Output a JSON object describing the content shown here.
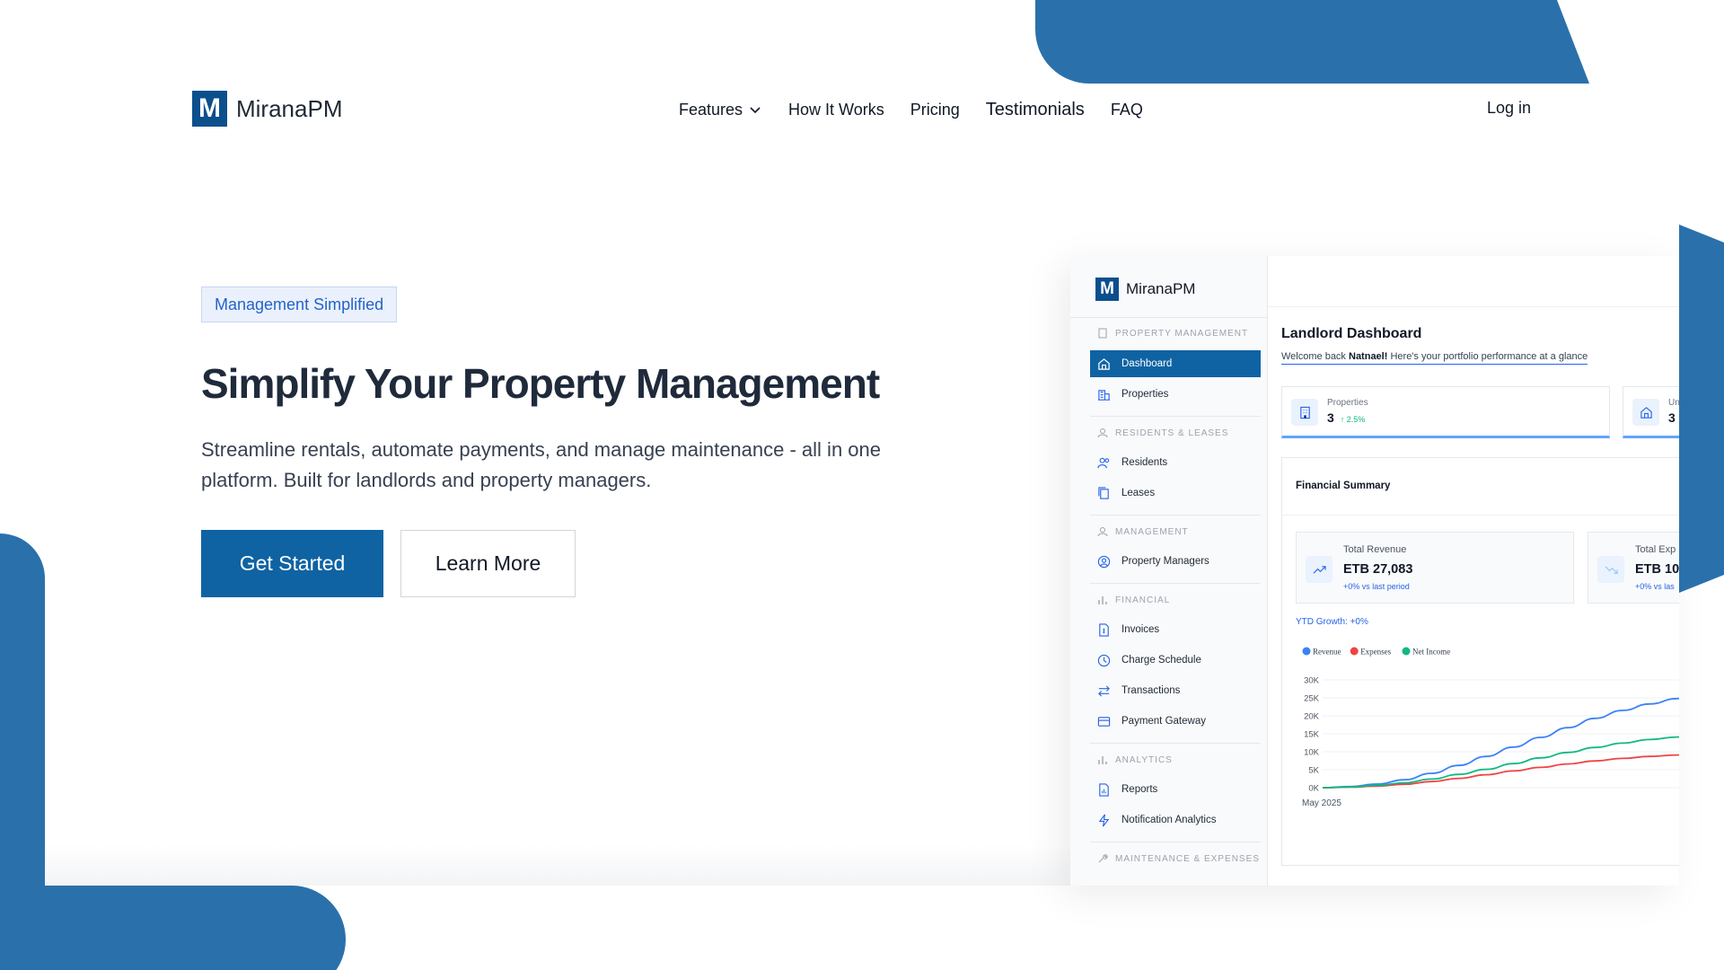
{
  "brand": {
    "name": "MiranaPM",
    "mark": "M",
    "color": "#0b4f8c"
  },
  "nav": {
    "items": [
      {
        "label": "Features",
        "has_dropdown": true
      },
      {
        "label": "How It Works"
      },
      {
        "label": "Pricing"
      },
      {
        "label": "Testimonials"
      },
      {
        "label": "FAQ"
      }
    ],
    "login": "Log in"
  },
  "hero": {
    "badge": "Management Simplified",
    "title": "Simplify Your Property Management",
    "subtitle": "Streamline rentals, automate payments, and manage maintenance - all in one platform. Built for landlords and property managers.",
    "primary_button": "Get Started",
    "secondary_button": "Learn More"
  },
  "colors": {
    "accent": "#0f63a3",
    "decor": "#2a71ac",
    "badge_text": "#2563c9"
  },
  "dashboard": {
    "brand": "MiranaPM",
    "sidebar": {
      "sections": [
        {
          "title": "PROPERTY MANAGEMENT",
          "items": [
            {
              "label": "Dashboard",
              "icon": "home-icon",
              "active": true
            },
            {
              "label": "Properties",
              "icon": "building-icon"
            }
          ]
        },
        {
          "title": "RESIDENTS & LEASES",
          "items": [
            {
              "label": "Residents",
              "icon": "users-icon"
            },
            {
              "label": "Leases",
              "icon": "copy-icon"
            }
          ]
        },
        {
          "title": "MANAGEMENT",
          "items": [
            {
              "label": "Property Managers",
              "icon": "user-circle-icon"
            }
          ]
        },
        {
          "title": "FINANCIAL",
          "items": [
            {
              "label": "Invoices",
              "icon": "invoice-icon"
            },
            {
              "label": "Charge Schedule",
              "icon": "clock-icon"
            },
            {
              "label": "Transactions",
              "icon": "swap-icon"
            },
            {
              "label": "Payment Gateway",
              "icon": "card-icon"
            }
          ]
        },
        {
          "title": "ANALYTICS",
          "items": [
            {
              "label": "Reports",
              "icon": "report-icon"
            },
            {
              "label": "Notification Analytics",
              "icon": "bolt-icon"
            }
          ]
        },
        {
          "title": "MAINTENANCE & EXPENSES",
          "items": []
        }
      ]
    },
    "header": {
      "title": "Landlord Dashboard",
      "welcome_prefix": "Welcome back",
      "user": "Natnael!",
      "welcome_suffix": "Here's your portfolio performance at a glance"
    },
    "cards": [
      {
        "label": "Properties",
        "value": "3",
        "change": "↑ 2.5%"
      },
      {
        "label": "Un",
        "value": "3"
      }
    ],
    "financial": {
      "title": "Financial Summary",
      "stats": [
        {
          "label": "Total Revenue",
          "value": "ETB 27,083",
          "change": "+0% vs last period"
        },
        {
          "label": "Total Exp",
          "value": "ETB 10,",
          "change": "+0% vs las"
        }
      ],
      "ytd": "YTD Growth: +0%"
    }
  },
  "chart_data": {
    "type": "line",
    "x": [
      "May 2025",
      "",
      "",
      "",
      "",
      "",
      "",
      "",
      "",
      "",
      "",
      ""
    ],
    "series": [
      {
        "name": "Revenue",
        "color": "#3b82f6",
        "values": [
          0,
          300,
          1000,
          2200,
          4000,
          6200,
          8700,
          11300,
          14000,
          16700,
          19300,
          21500,
          23300,
          24800,
          25600
        ]
      },
      {
        "name": "Expenses",
        "color": "#ef4444",
        "values": [
          0,
          150,
          450,
          950,
          1700,
          2600,
          3600,
          4650,
          5650,
          6600,
          7450,
          8150,
          8700,
          9100,
          9300
        ]
      },
      {
        "name": "Net Income",
        "color": "#10b981",
        "values": [
          0,
          200,
          650,
          1350,
          2400,
          3700,
          5100,
          6700,
          8300,
          9800,
          11200,
          12400,
          13400,
          14100,
          14500
        ]
      }
    ],
    "yticks": [
      "30K",
      "25K",
      "20K",
      "15K",
      "10K",
      "5K",
      "0K"
    ],
    "ylim": [
      0,
      30000
    ],
    "xlabel_first": "May 2025",
    "legend_position": "top-left"
  }
}
